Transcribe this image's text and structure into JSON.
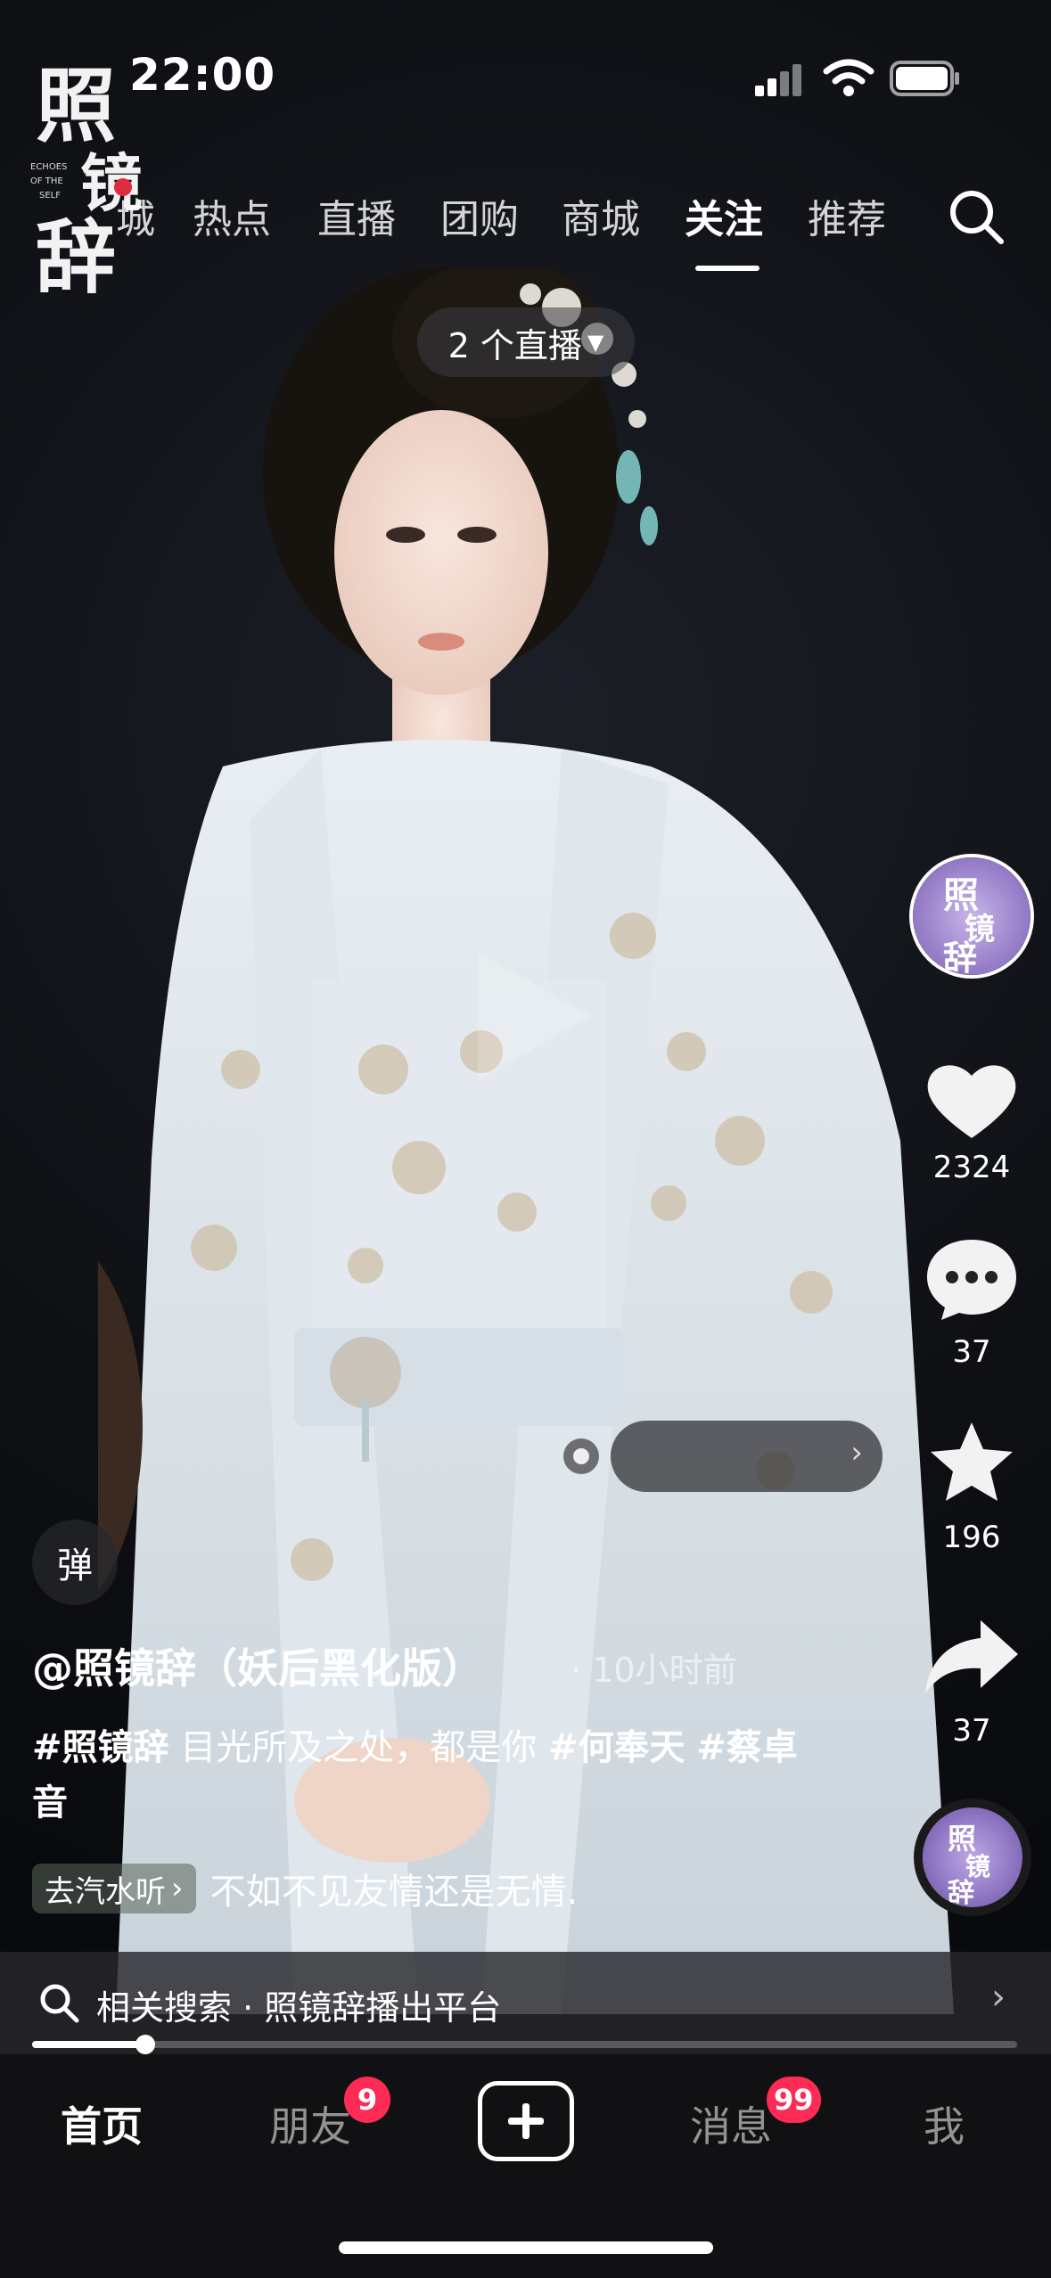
{
  "status_bar": {
    "time": "22:00"
  },
  "brand_logo": {
    "text": "照镜辞",
    "subtitle": "ECHOES OF THE SELF"
  },
  "top_tabs": {
    "items": [
      {
        "label": "城"
      },
      {
        "label": "热点"
      },
      {
        "label": "直播"
      },
      {
        "label": "团购"
      },
      {
        "label": "商城"
      },
      {
        "label": "关注",
        "active": true
      },
      {
        "label": "推荐"
      }
    ]
  },
  "live_pill": {
    "label": "2 个直播"
  },
  "right_rail": {
    "likes": "2324",
    "comments": "37",
    "favorites": "196",
    "shares": "37"
  },
  "danmaku": {
    "label": "弹"
  },
  "caption": {
    "author": "@照镜辞（妖后黑化版）",
    "time_ago": "· 10小时前",
    "hashtag1": "#照镜辞",
    "text": " 目光所及之处，都是你 ",
    "hashtag2": "#何奉天",
    "hashtag3": "#蔡卓音"
  },
  "music": {
    "chip_label": "去汽水听",
    "chip_arrow": "›",
    "song": "不如不见友情还是无情."
  },
  "related_search": {
    "label": "相关搜索 · 照镜辞播出平台",
    "chevron": "›"
  },
  "progress": {
    "fraction": 0.115
  },
  "bottom_nav": {
    "home": "首页",
    "friends": "朋友",
    "friends_badge": "9",
    "messages": "消息",
    "messages_badge": "99",
    "me": "我"
  },
  "colors": {
    "badge": "#fe2c55",
    "background": "#0e1014"
  }
}
